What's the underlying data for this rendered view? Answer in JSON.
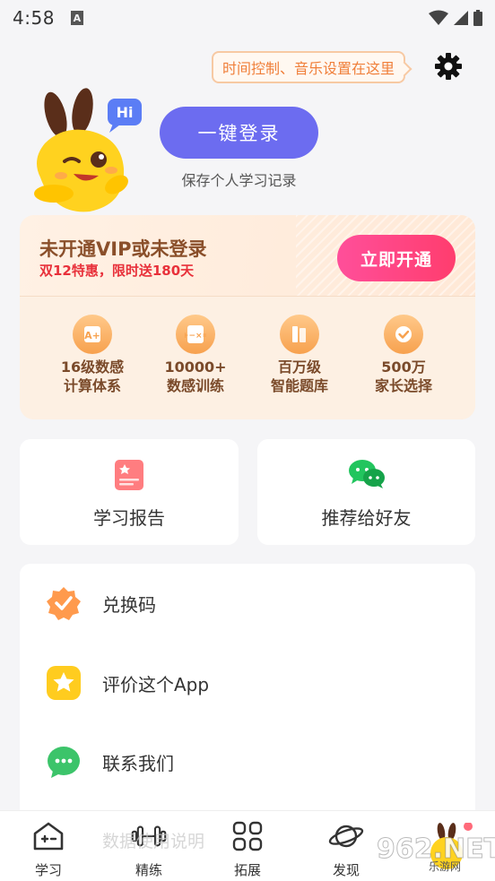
{
  "status": {
    "time": "4:58"
  },
  "header": {
    "tip": "时间控制、音乐设置在这里",
    "mascot_greeting": "Hi",
    "login_label": "一键登录",
    "login_sub": "保存个人学习记录"
  },
  "vip": {
    "title": "未开通VIP或未登录",
    "subtitle": "双12特惠，限时送180天",
    "button": "立即开通",
    "features": [
      {
        "icon": "grade-book-icon",
        "line1": "16级数感",
        "line2": "计算体系"
      },
      {
        "icon": "calculator-icon",
        "line1": "10000+",
        "line2": "数感训练"
      },
      {
        "icon": "book-shelf-icon",
        "line1": "百万级",
        "line2": "智能题库"
      },
      {
        "icon": "heart-check-icon",
        "line1": "500万",
        "line2": "家长选择"
      }
    ]
  },
  "quick": {
    "report": "学习报告",
    "share": "推荐给好友"
  },
  "menu": [
    {
      "icon": "badge-check-icon",
      "label": "兑换码"
    },
    {
      "icon": "star-icon",
      "label": "评价这个App"
    },
    {
      "icon": "chat-icon",
      "label": "联系我们"
    }
  ],
  "partial": {
    "text": "数据使用说明"
  },
  "tabs": [
    {
      "icon": "home-plus-icon",
      "label": "学习"
    },
    {
      "icon": "dumbbell-icon",
      "label": "精练"
    },
    {
      "icon": "grid-icon",
      "label": "拓展"
    },
    {
      "icon": "planet-icon",
      "label": "发现"
    }
  ],
  "watermark": {
    "brand": "962.NET",
    "sub": "乐游网"
  },
  "colors": {
    "primary": "#6c6cf0",
    "vip_accent": "#ff4f9a",
    "orange": "#f7a14e"
  }
}
